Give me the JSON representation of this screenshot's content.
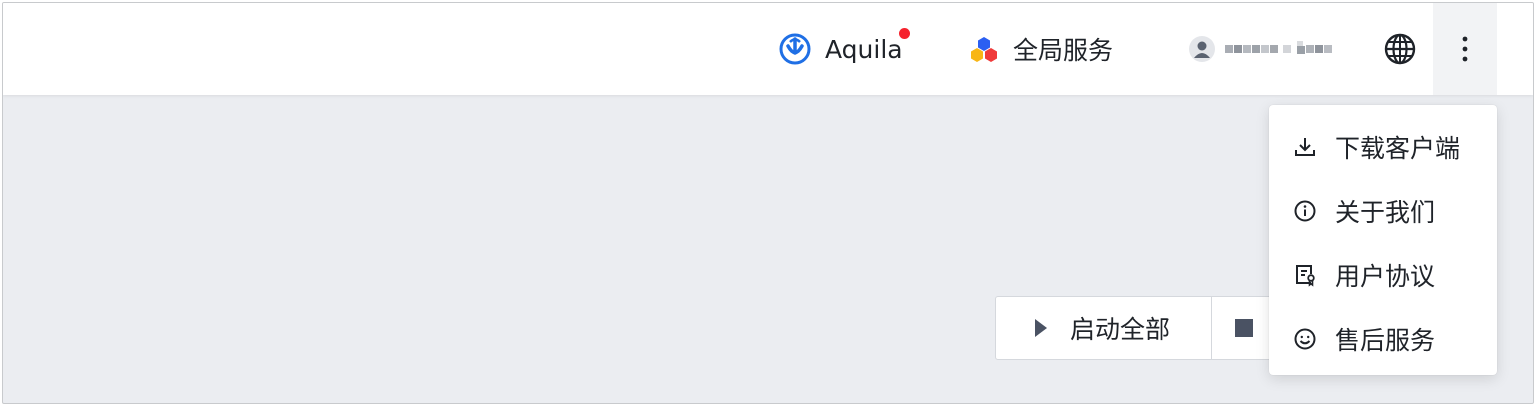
{
  "header": {
    "aquila_label": "Aquila",
    "global_services_label": "全局服务",
    "user_name": "",
    "notification_color": "#f5222d",
    "accent_color": "#1f6fe5"
  },
  "dropdown_menu": {
    "items": [
      {
        "label": "下载客户端",
        "icon": "download-icon"
      },
      {
        "label": "关于我们",
        "icon": "info-icon"
      },
      {
        "label": "用户协议",
        "icon": "agreement-icon"
      },
      {
        "label": "售后服务",
        "icon": "smile-icon"
      }
    ]
  },
  "actions": {
    "start_all_label": "启动全部",
    "stop_all_label": ""
  }
}
